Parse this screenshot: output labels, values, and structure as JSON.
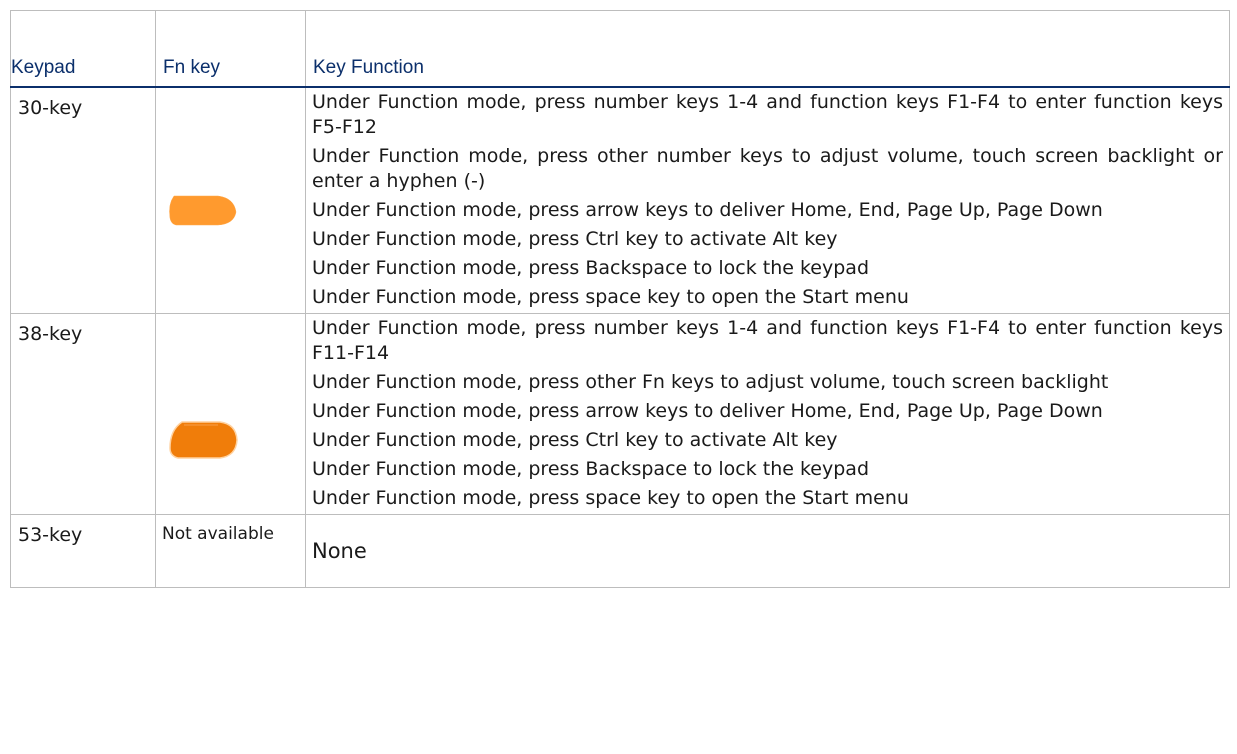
{
  "table": {
    "headers": {
      "keypad": "Keypad",
      "fn_key": "Fn key",
      "key_function": "Key Function"
    },
    "rows": [
      {
        "keypad": "30-key",
        "fn_key_icon": "orange-fn-key-icon",
        "fn_key_color": "#ff9a2e",
        "functions": [
          "Under Function mode, press number keys 1-4 and function keys F1-F4 to enter function keys F5-F12",
          "Under Function mode, press other number keys to adjust volume, touch screen backlight or enter a hyphen (-)",
          "Under Function mode, press arrow keys to deliver Home, End, Page Up, Page Down",
          "Under Function mode, press Ctrl key to activate Alt key",
          "Under Function mode, press Backspace to lock the keypad",
          "Under Function mode, press space key to open the Start menu"
        ]
      },
      {
        "keypad": "38-key",
        "fn_key_icon": "orange-fn-key-icon",
        "fn_key_color": "#f07d0a",
        "functions": [
          "Under Function mode, press number keys 1-4 and function keys F1-F4 to enter function keys F11-F14",
          "Under Function mode, press other Fn keys to adjust volume, touch screen backlight",
          "Under Function mode, press arrow keys to deliver Home, End, Page Up, Page Down",
          "Under Function mode, press Ctrl key to activate Alt key",
          "Under Function mode, press Backspace to lock the keypad",
          "Under Function mode, press space key to open the Start menu"
        ]
      },
      {
        "keypad": "53-key",
        "fn_key": "Not available",
        "key_function": "None"
      }
    ]
  },
  "colors": {
    "header_text": "#0b2f6b",
    "border": "#bdbdbd"
  }
}
